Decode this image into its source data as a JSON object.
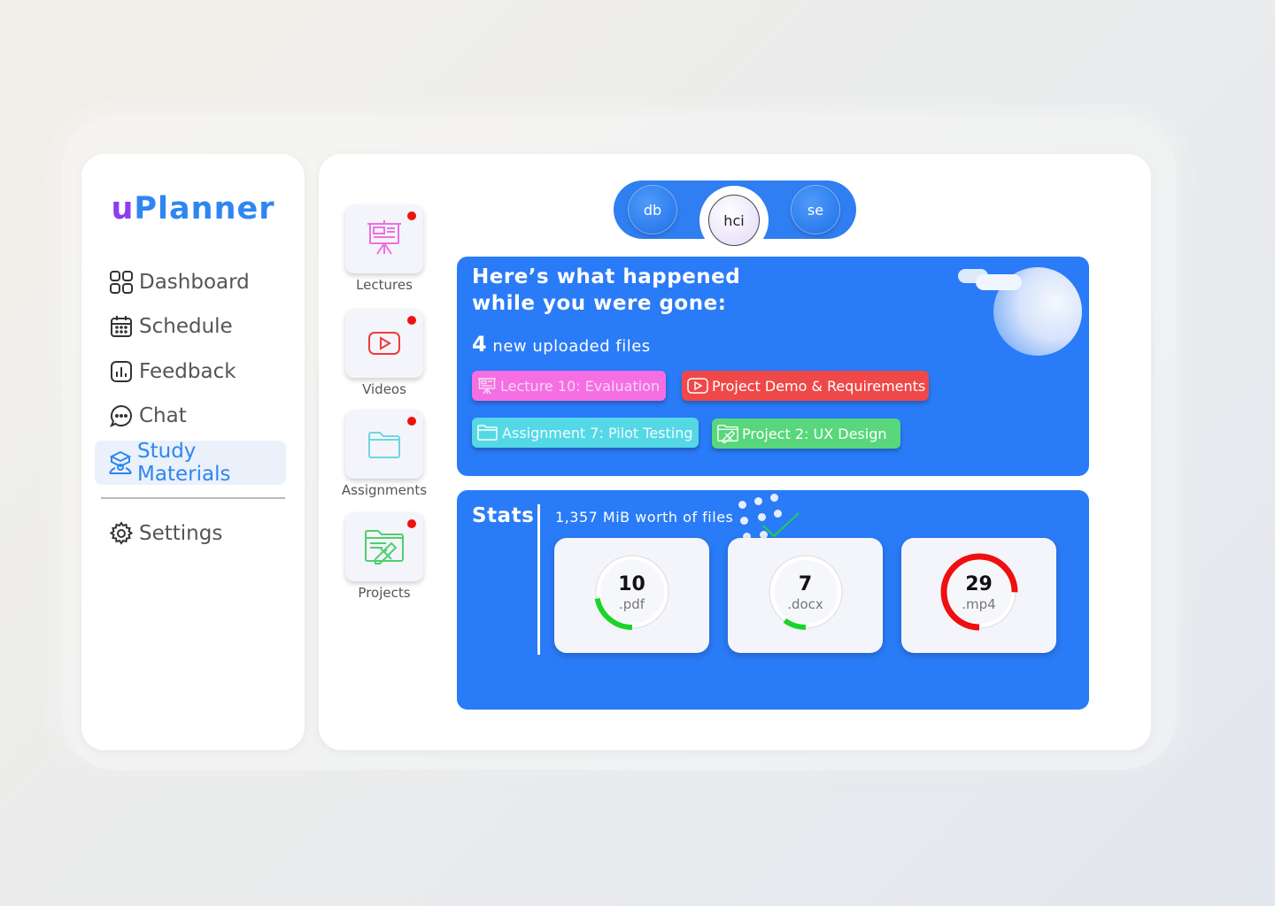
{
  "app": {
    "logo_prefix": "u",
    "logo_rest": "Planner"
  },
  "sidebar": {
    "items": [
      {
        "label": "Dashboard",
        "icon": "grid-icon"
      },
      {
        "label": "Schedule",
        "icon": "calendar-icon"
      },
      {
        "label": "Feedback",
        "icon": "chart-icon"
      },
      {
        "label": "Chat",
        "icon": "chat-bubble-icon"
      },
      {
        "label": "Study Materials",
        "icon": "study-materials-icon",
        "active": true
      }
    ],
    "settings_label": "Settings"
  },
  "categories": [
    {
      "label": "Lectures",
      "icon": "presentation-icon",
      "has_new": true
    },
    {
      "label": "Videos",
      "icon": "video-play-icon",
      "has_new": true
    },
    {
      "label": "Assignments",
      "icon": "folder-icon",
      "has_new": true
    },
    {
      "label": "Projects",
      "icon": "project-folder-icon",
      "has_new": true
    }
  ],
  "courses": [
    {
      "label": "db",
      "active": false
    },
    {
      "label": "hci",
      "active": true
    },
    {
      "label": "se",
      "active": false
    }
  ],
  "updates": {
    "heading": "Here’s what happened while you were gone:",
    "count": "4",
    "count_label": " new uploaded files",
    "files": [
      {
        "label": "Lecture 10: Evaluation",
        "color": "#f56ee3",
        "text_color": "#f5d9f2",
        "icon": "presentation-icon"
      },
      {
        "label": "Project Demo & Requirements",
        "color": "#ef4848",
        "text_color": "#ffffff",
        "icon": "video-play-icon"
      },
      {
        "label": "Assignment 7: Pilot Testing",
        "color": "#55d8e6",
        "text_color": "#eafcff",
        "icon": "folder-icon"
      },
      {
        "label": "Project 2: UX Design",
        "color": "#58d77c",
        "text_color": "#ffffff",
        "icon": "project-folder-icon"
      }
    ]
  },
  "stats": {
    "title": "Stats",
    "total": "1,357 MiB worth of files",
    "types": [
      {
        "count": "10",
        "ext": ".pdf",
        "ring_color": "#19d42a",
        "fraction": 0.22
      },
      {
        "count": "7",
        "ext": ".docx",
        "ring_color": "#19d42a",
        "fraction": 0.1
      },
      {
        "count": "29",
        "ext": ".mp4",
        "ring_color": "#ee0f0f",
        "fraction": 0.75
      }
    ]
  },
  "colors": {
    "accent_blue": "#2a7bf7",
    "logo_purple": "#8a3ff0",
    "notification_red": "#ee1111"
  }
}
